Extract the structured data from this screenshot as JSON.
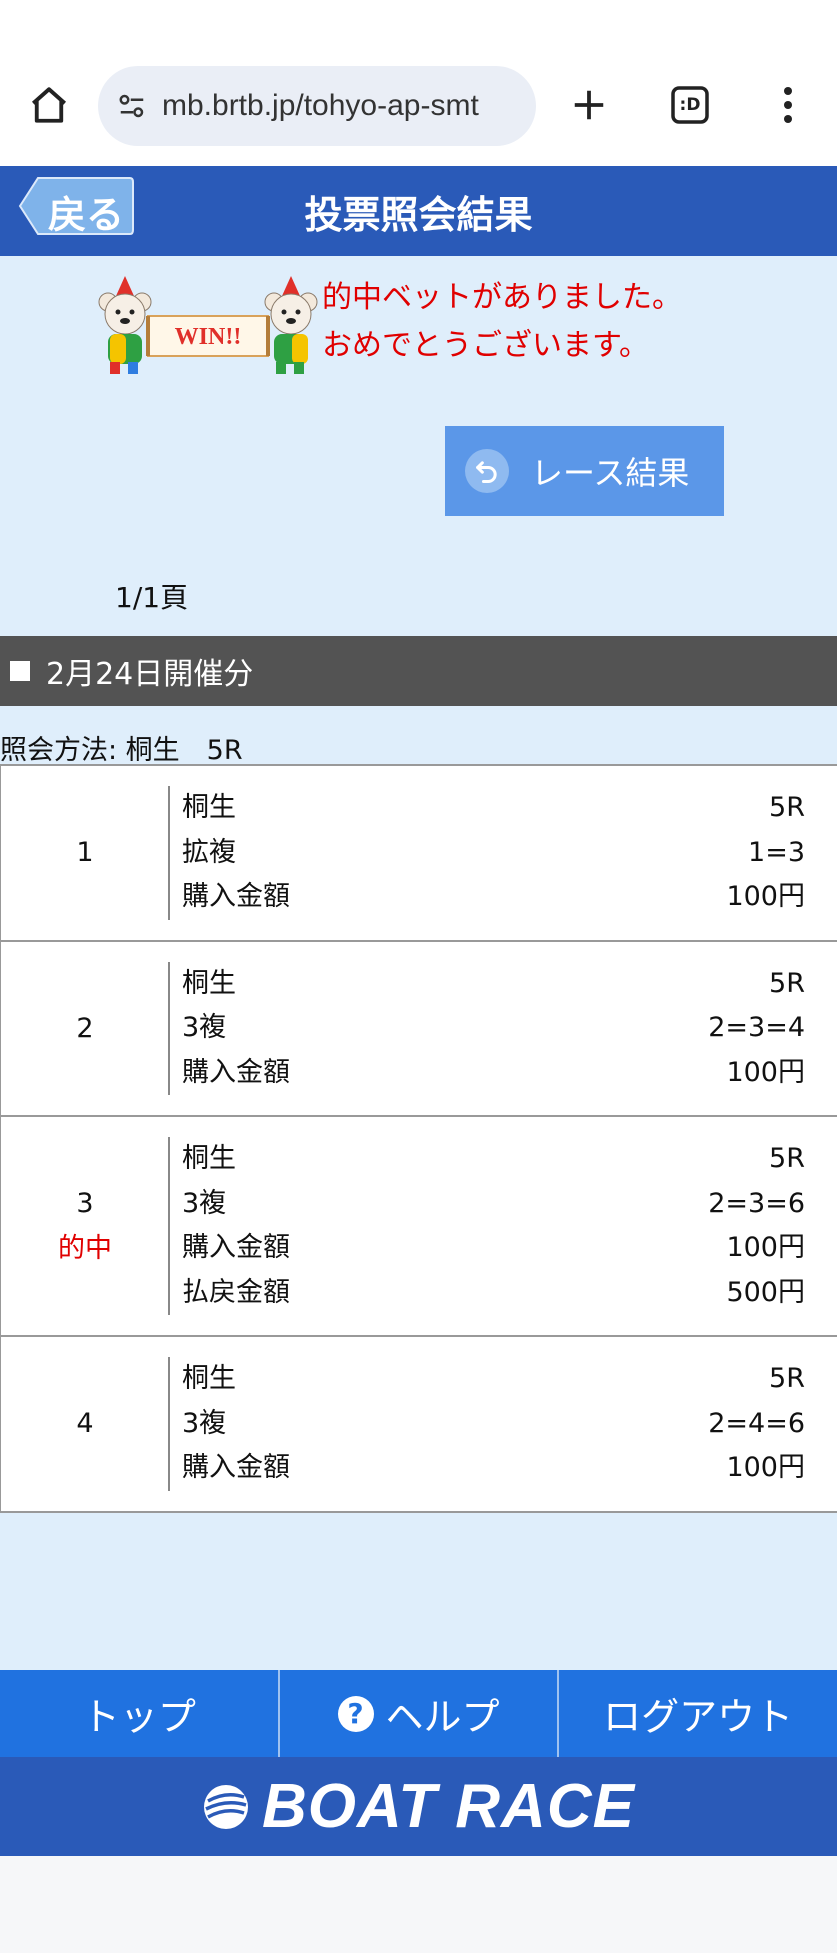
{
  "browser": {
    "url": "mb.brtb.jp/tohyo-ap-smt",
    "tabs_badge": ":D"
  },
  "header": {
    "back_label": "戻る",
    "title": "投票照会結果"
  },
  "win": {
    "banner_text": "WIN!!",
    "line1": "的中ベットがありました。",
    "line2": "おめでとうございます。"
  },
  "race_result_button": "レース結果",
  "page_count": "1/1頁",
  "date_header": "2月24日開催分",
  "method": "照会方法: 桐生　5R",
  "bets": [
    {
      "num": "1",
      "hit": "",
      "lines": [
        {
          "label": "桐生",
          "value": "5R"
        },
        {
          "label": "拡複",
          "value": "1=3"
        },
        {
          "label": "購入金額",
          "value": "100円"
        }
      ]
    },
    {
      "num": "2",
      "hit": "",
      "lines": [
        {
          "label": "桐生",
          "value": "5R"
        },
        {
          "label": "3複",
          "value": "2=3=4"
        },
        {
          "label": "購入金額",
          "value": "100円"
        }
      ]
    },
    {
      "num": "3",
      "hit": "的中",
      "lines": [
        {
          "label": "桐生",
          "value": "5R"
        },
        {
          "label": "3複",
          "value": "2=3=6"
        },
        {
          "label": "購入金額",
          "value": "100円"
        },
        {
          "label": "払戻金額",
          "value": "500円"
        }
      ]
    },
    {
      "num": "4",
      "hit": "",
      "lines": [
        {
          "label": "桐生",
          "value": "5R"
        },
        {
          "label": "3複",
          "value": "2=4=6"
        },
        {
          "label": "購入金額",
          "value": "100円"
        }
      ]
    }
  ],
  "footer": {
    "top": "トップ",
    "help": "ヘルプ",
    "logout": "ログアウト"
  },
  "brand": "BOAT RACE",
  "colors": {
    "header_blue": "#2a5ab8",
    "footer_blue": "#2072e0",
    "hit_red": "#e00000",
    "page_bg": "#dfeefb"
  }
}
